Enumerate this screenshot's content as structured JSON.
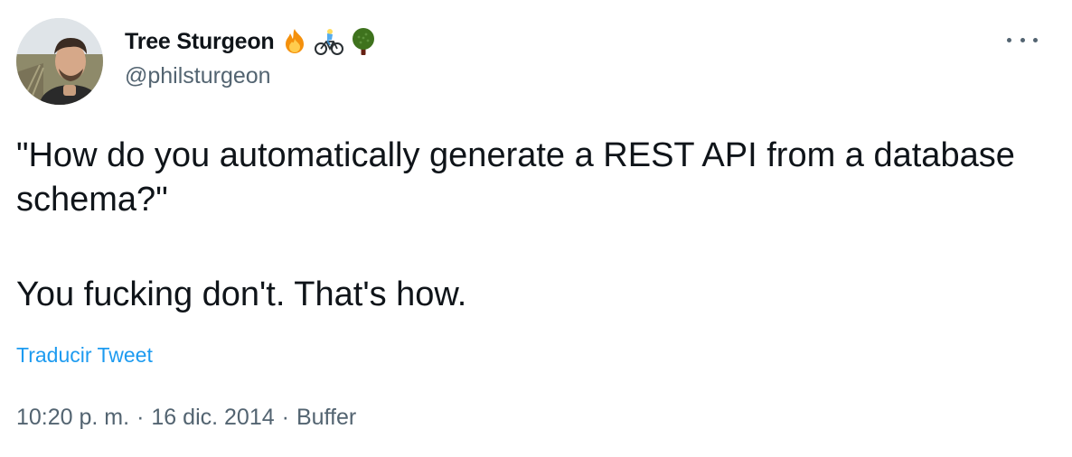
{
  "author": {
    "display_name": "Tree Sturgeon",
    "handle": "@philsturgeon",
    "badges": [
      "fire-icon",
      "cyclist-icon",
      "tree-icon"
    ]
  },
  "tweet": {
    "paragraph_1": "\"How do you automatically generate a REST API from a database schema?\"",
    "paragraph_2": "You fucking don't. That's how.",
    "translate_label": "Traducir Tweet"
  },
  "meta": {
    "time": "10:20 p. m.",
    "separator": "·",
    "date": "16 dic. 2014",
    "source": "Buffer"
  },
  "colors": {
    "text_primary": "#0f1419",
    "text_secondary": "#536471",
    "link": "#1d9bf0"
  }
}
